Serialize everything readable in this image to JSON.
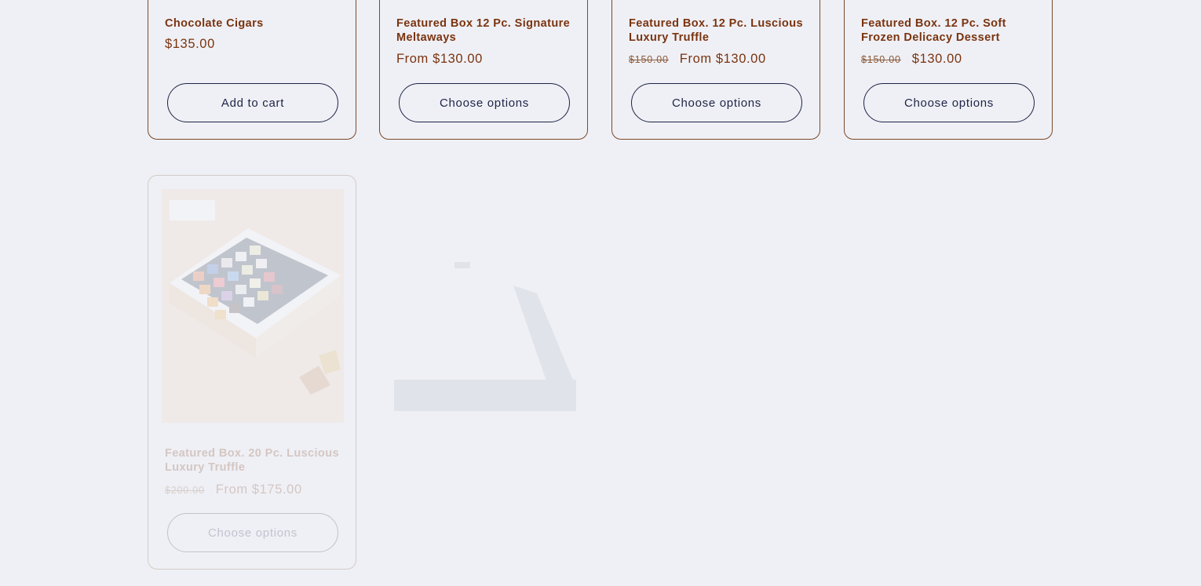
{
  "products": [
    {
      "title": "Chocolate Cigars",
      "compare_price": "",
      "price": "$135.00",
      "button": "Add to cart"
    },
    {
      "title": "Featured Box 12 Pc. Signature Meltaways",
      "compare_price": "",
      "price": "From $130.00",
      "button": "Choose options"
    },
    {
      "title": "Featured Box. 12 Pc. Luscious Luxury Truffle",
      "compare_price": "$150.00",
      "price": "From $130.00",
      "button": "Choose options"
    },
    {
      "title": "Featured Box. 12 Pc. Soft Frozen Delicacy Dessert",
      "compare_price": "$150.00",
      "price": "$130.00",
      "button": "Choose options"
    },
    {
      "title": "Featured Box. 20 Pc. Luscious Luxury Truffle",
      "compare_price": "$200.00",
      "price": "From $175.00",
      "button": "Choose options",
      "badge": ""
    }
  ],
  "colors": {
    "background": "#eff0f5",
    "title": "#7a3410",
    "button_border": "#1d2347",
    "card_border": "#7a4a2a"
  }
}
